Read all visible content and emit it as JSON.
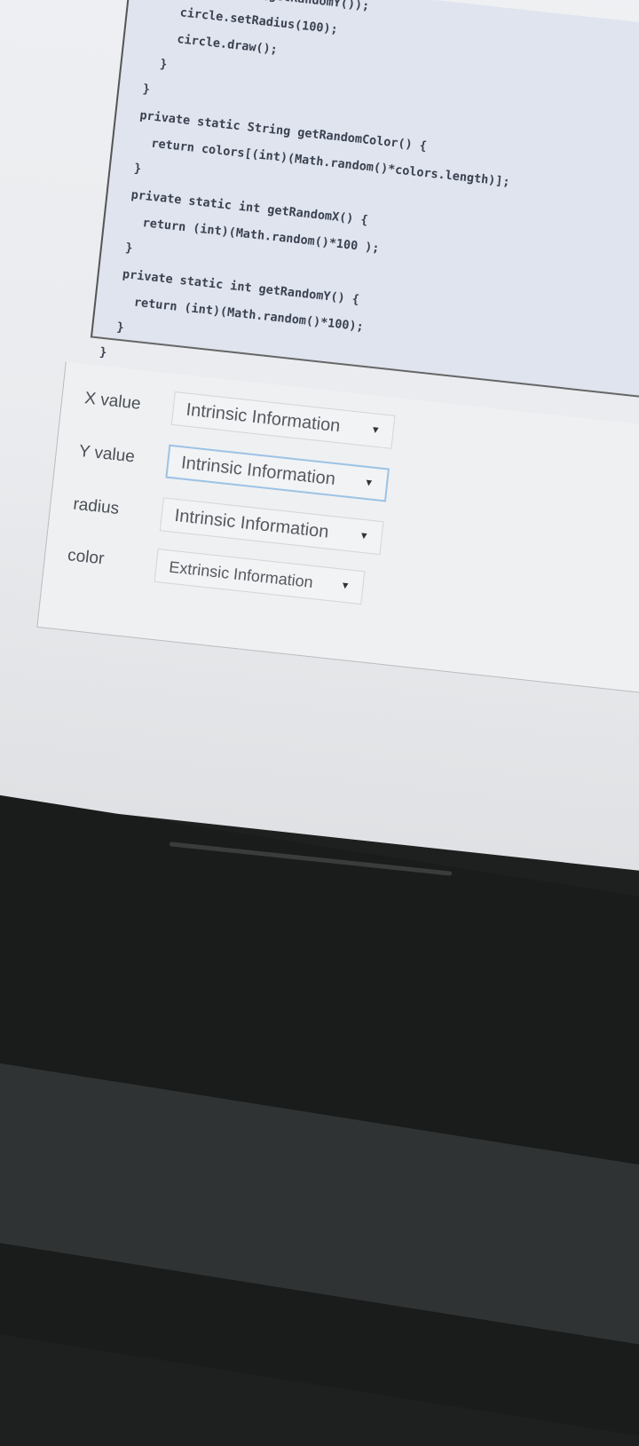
{
  "code": {
    "lines": [
      "      circle.setY(getRandomY());",
      "      circle.setRadius(100);",
      "      circle.draw();",
      "    }",
      "  }",
      "  private static String getRandomColor() {",
      "    return colors[(int)(Math.random()*colors.length)];",
      "  }",
      "  private static int getRandomX() {",
      "    return (int)(Math.random()*100 );",
      "  }",
      "  private static int getRandomY() {",
      "    return (int)(Math.random()*100);",
      "  }",
      "}"
    ]
  },
  "form": {
    "rows": [
      {
        "label": "X value",
        "value": "Intrinsic Information"
      },
      {
        "label": "Y value",
        "value": "Intrinsic Information"
      },
      {
        "label": "radius",
        "value": "Intrinsic Information"
      },
      {
        "label": "color",
        "value": "Extrinsic Information"
      }
    ]
  }
}
